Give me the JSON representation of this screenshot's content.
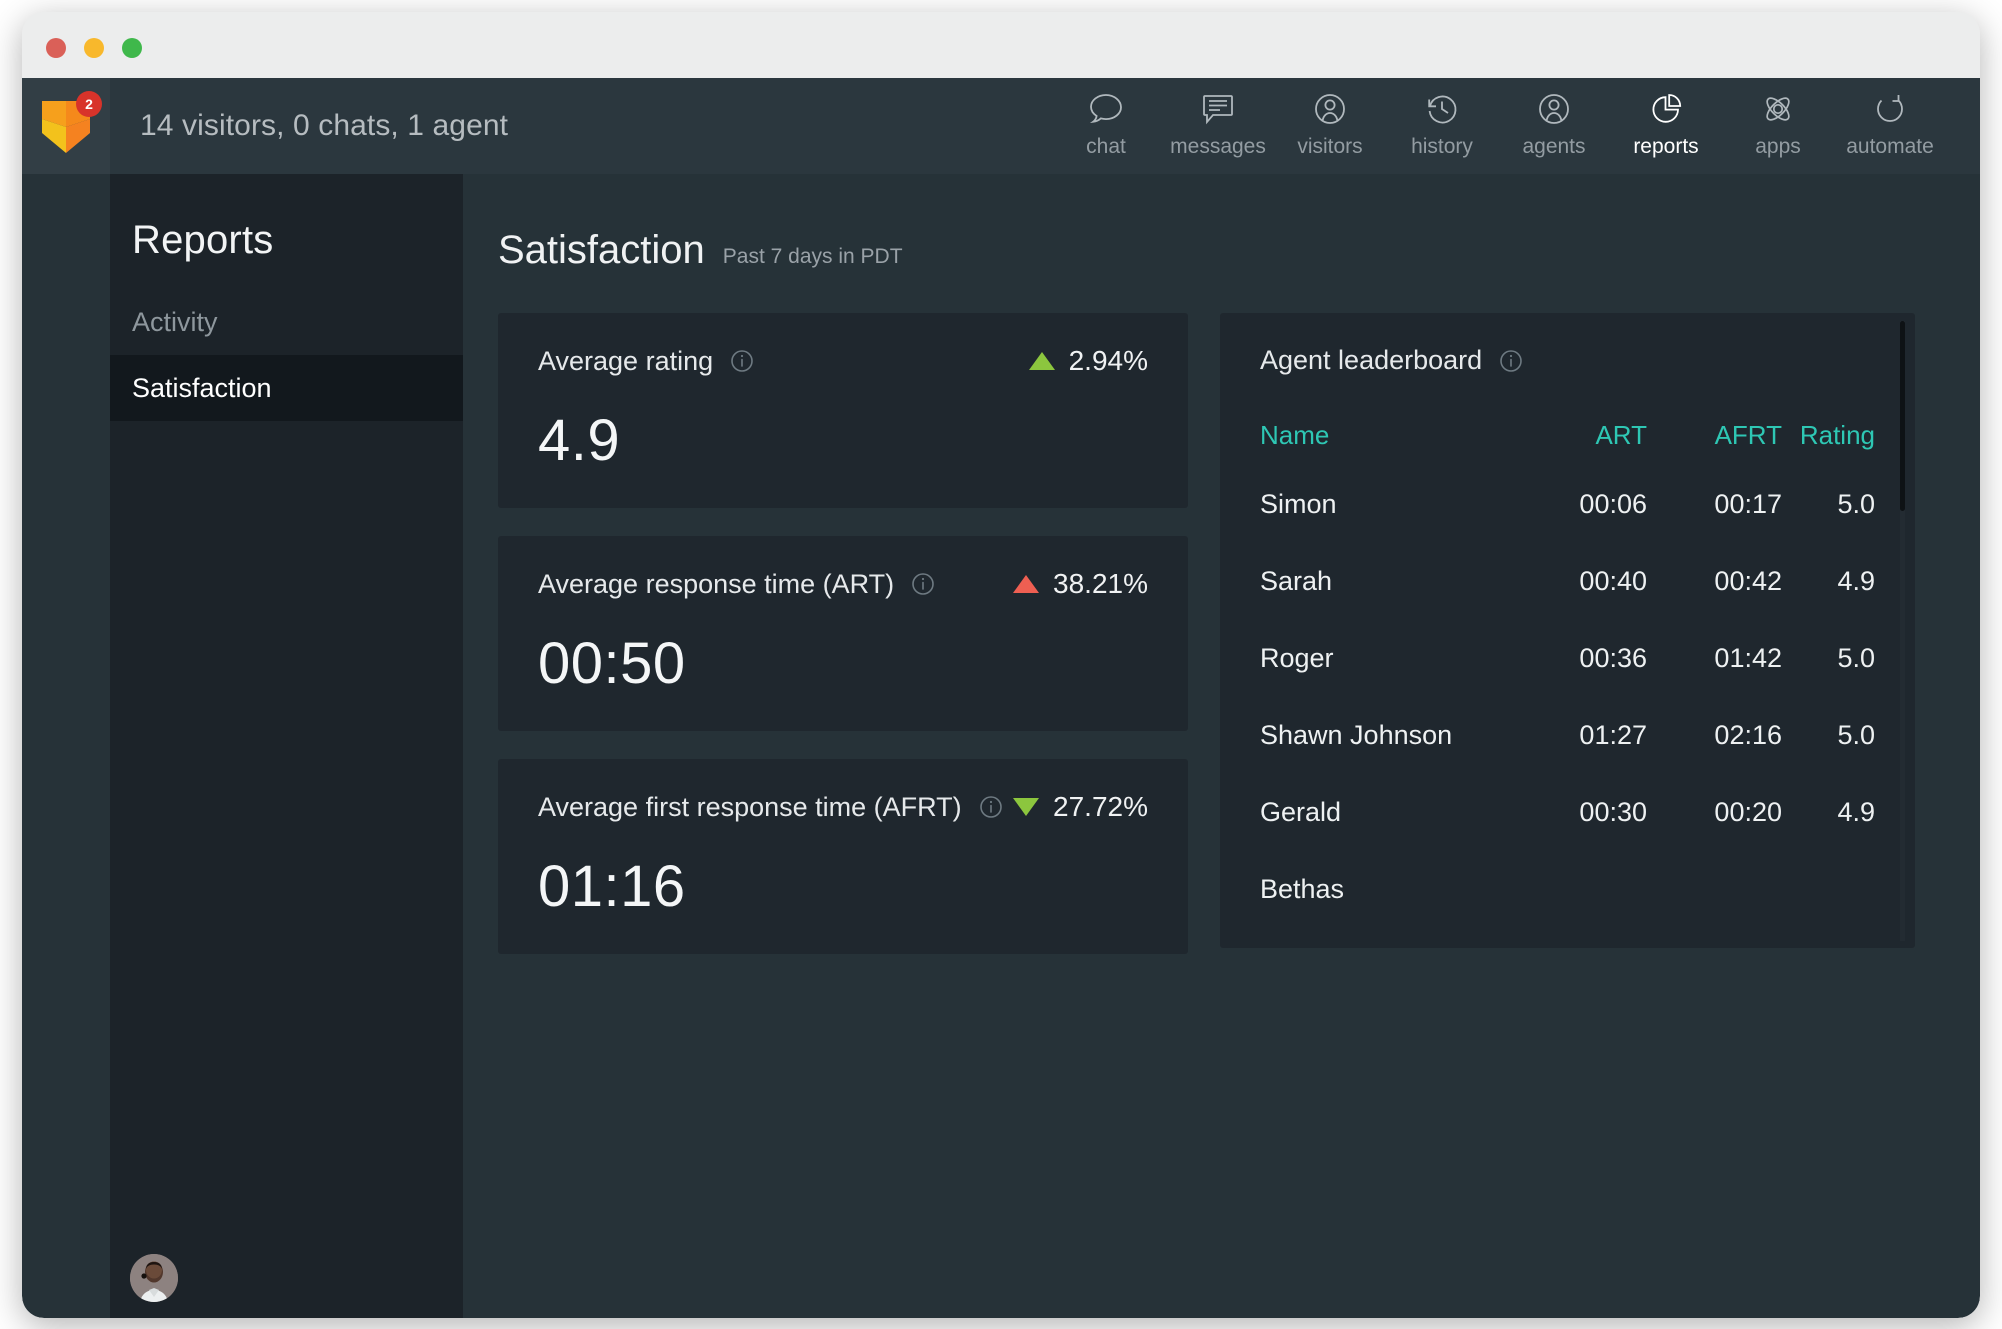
{
  "window": {
    "traffic_lights": [
      "close",
      "minimize",
      "maximize"
    ]
  },
  "topbar": {
    "logo": {
      "name": "fox-logo",
      "badge_count": "2",
      "badge_color": "#d8332a",
      "colors": [
        "#f5a623",
        "#f47b20",
        "#f2c01f"
      ]
    },
    "status": "14 visitors, 0 chats, 1 agent",
    "nav": [
      {
        "id": "chat",
        "label": "chat",
        "icon": "chat-bubble-icon",
        "active": false
      },
      {
        "id": "messages",
        "label": "messages",
        "icon": "message-lines-icon",
        "active": false
      },
      {
        "id": "visitors",
        "label": "visitors",
        "icon": "visitor-icon",
        "active": false
      },
      {
        "id": "history",
        "label": "history",
        "icon": "clock-back-icon",
        "active": false
      },
      {
        "id": "agents",
        "label": "agents",
        "icon": "agent-icon",
        "active": false
      },
      {
        "id": "reports",
        "label": "reports",
        "icon": "pie-chart-icon",
        "active": true
      },
      {
        "id": "apps",
        "label": "apps",
        "icon": "atom-icon",
        "active": false
      },
      {
        "id": "automate",
        "label": "automate",
        "icon": "refresh-loop-icon",
        "active": false
      }
    ]
  },
  "sidebar": {
    "title": "Reports",
    "items": [
      {
        "id": "activity",
        "label": "Activity",
        "active": false
      },
      {
        "id": "satisfaction",
        "label": "Satisfaction",
        "active": true
      }
    ],
    "avatar_name": "current-user-avatar"
  },
  "main": {
    "page_title": "Satisfaction",
    "page_subtitle": "Past 7 days in PDT",
    "metrics": [
      {
        "id": "average-rating",
        "label": "Average rating",
        "value": "4.9",
        "delta": "2.94%",
        "direction": "up",
        "delta_color": "#8cc63e"
      },
      {
        "id": "average-response-time",
        "label": "Average response time (ART)",
        "value": "00:50",
        "delta": "38.21%",
        "direction": "up",
        "delta_color": "#ee5f52"
      },
      {
        "id": "average-first-response-time",
        "label": "Average first response time (AFRT)",
        "value": "01:16",
        "delta": "27.72%",
        "direction": "down",
        "delta_color": "#8cc63e"
      }
    ],
    "leaderboard": {
      "title": "Agent leaderboard",
      "header_color": "#2ec7b4",
      "columns": [
        "Name",
        "ART",
        "AFRT",
        "Rating"
      ],
      "rows": [
        {
          "name": "Simon",
          "art": "00:06",
          "afrt": "00:17",
          "rating": "5.0"
        },
        {
          "name": "Sarah",
          "art": "00:40",
          "afrt": "00:42",
          "rating": "4.9"
        },
        {
          "name": "Roger",
          "art": "00:36",
          "afrt": "01:42",
          "rating": "5.0"
        },
        {
          "name": "Shawn Johnson",
          "art": "01:27",
          "afrt": "02:16",
          "rating": "5.0"
        },
        {
          "name": "Gerald",
          "art": "00:30",
          "afrt": "00:20",
          "rating": "4.9"
        },
        {
          "name": "Bethas",
          "art": "",
          "afrt": "",
          "rating": ""
        }
      ]
    }
  },
  "theme": {
    "app_bg": "#263238",
    "topbar_bg": "#2b373e",
    "sidebar_bg": "#1c2329",
    "sidebar_active_bg": "#12181d",
    "card_bg": "#1f272e",
    "accent_teal": "#2ec7b4",
    "positive": "#8cc63e",
    "negative": "#ee5f52"
  }
}
